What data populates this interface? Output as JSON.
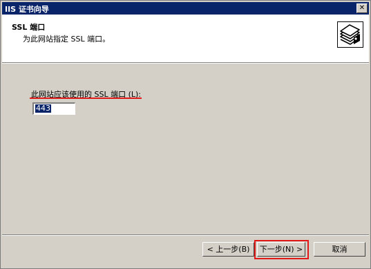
{
  "window": {
    "title": "IIS 证书向导",
    "close_glyph": "✕"
  },
  "header": {
    "title": "SSL 端口",
    "subtitle": "为此网站指定 SSL 端口。",
    "icon": "certificate-stack-icon"
  },
  "form": {
    "port_label_prefix": "此网站应该使用的 SSL 端口 (",
    "port_label_mnemonic": "L",
    "port_label_suffix": "):",
    "port_value": "443"
  },
  "buttons": {
    "back": "< 上一步(B)",
    "next": "下一步(N) >",
    "cancel": "取消"
  },
  "colors": {
    "titlebar": "#0a246a",
    "highlight": "#e01818",
    "face": "#d4d0c8"
  }
}
